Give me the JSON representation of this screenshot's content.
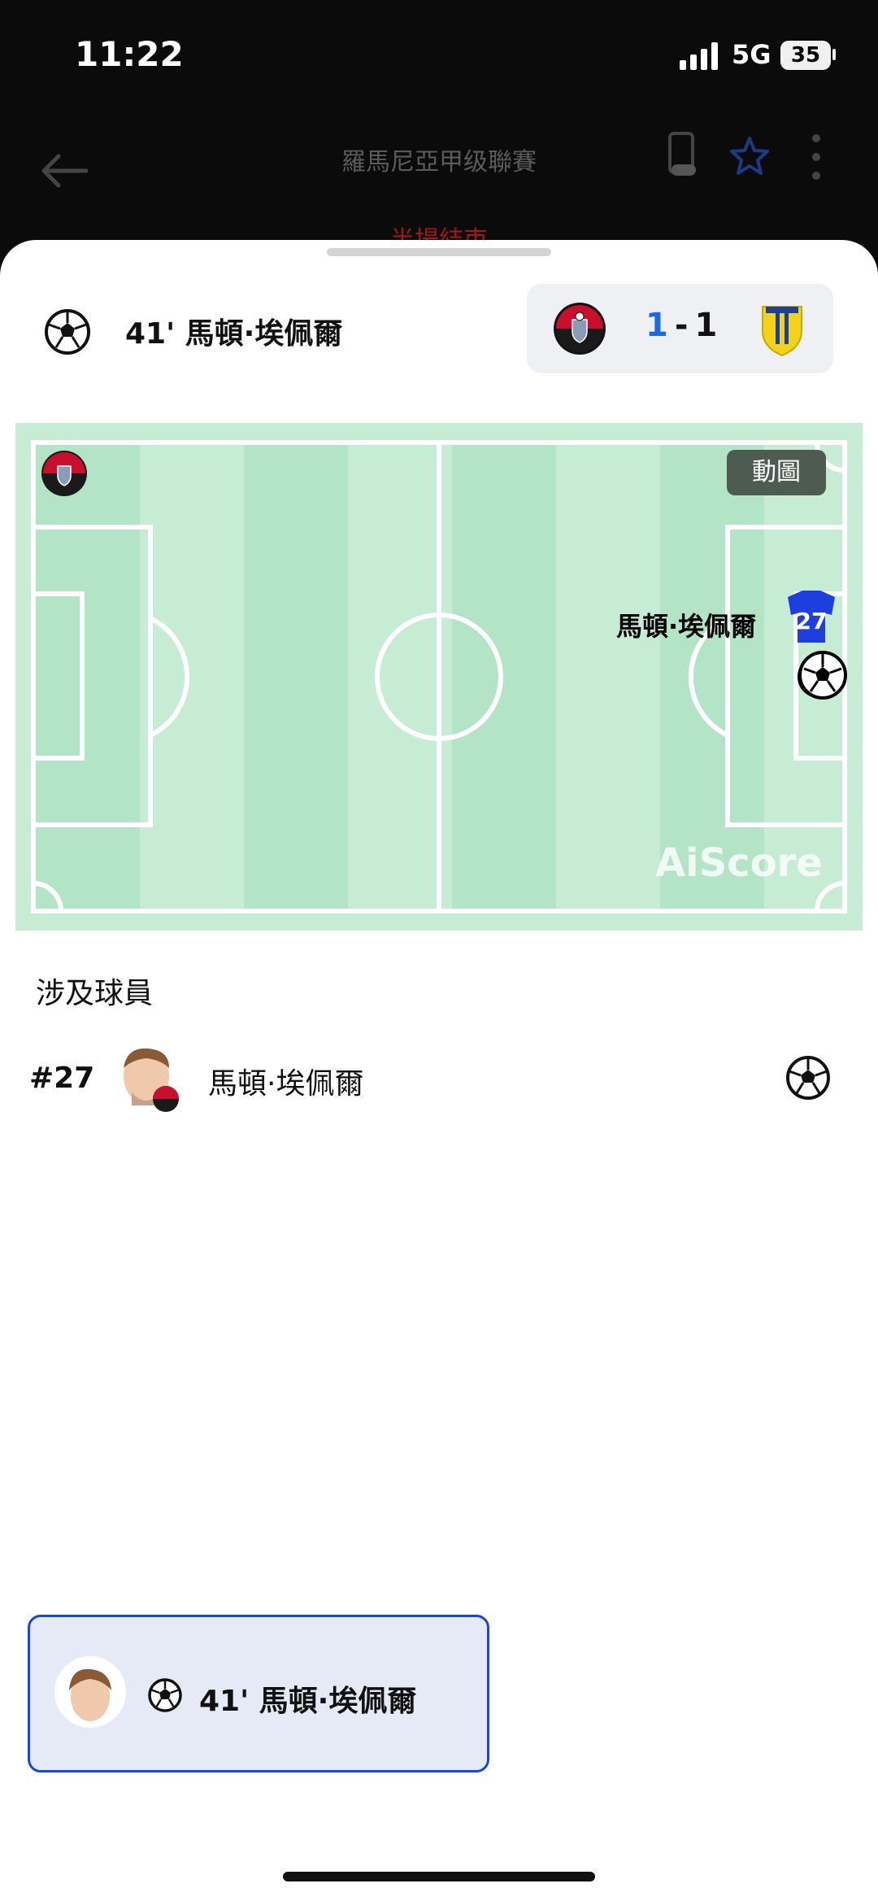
{
  "status_bar": {
    "time": "11:22",
    "network": "5G",
    "battery": "35"
  },
  "header": {
    "title": "羅馬尼亞甲级聯賽",
    "subtitle": "半場結束"
  },
  "event": {
    "minute": "41'",
    "player": "馬頓·埃佩爾"
  },
  "score": {
    "home": "1",
    "separator": "-",
    "away": "1"
  },
  "pitch": {
    "gif_label": "動圖",
    "player_label": "馬頓·埃佩爾",
    "jersey_number": "27",
    "watermark": "AiScore"
  },
  "involved": {
    "title": "涉及球員",
    "players": [
      {
        "number": "#27",
        "name": "馬頓·埃佩爾"
      }
    ]
  },
  "toast": {
    "text": "41' 馬頓·埃佩爾"
  },
  "colors": {
    "accent": "#1a47d6",
    "pitch_light": "#c6ecd4",
    "pitch_dark": "#b3e4c6",
    "home_score": "#1a6ae8"
  },
  "icons": [
    "back-arrow-icon",
    "phone-toggle-icon",
    "star-icon",
    "more-icon",
    "football-icon",
    "jersey-icon"
  ]
}
